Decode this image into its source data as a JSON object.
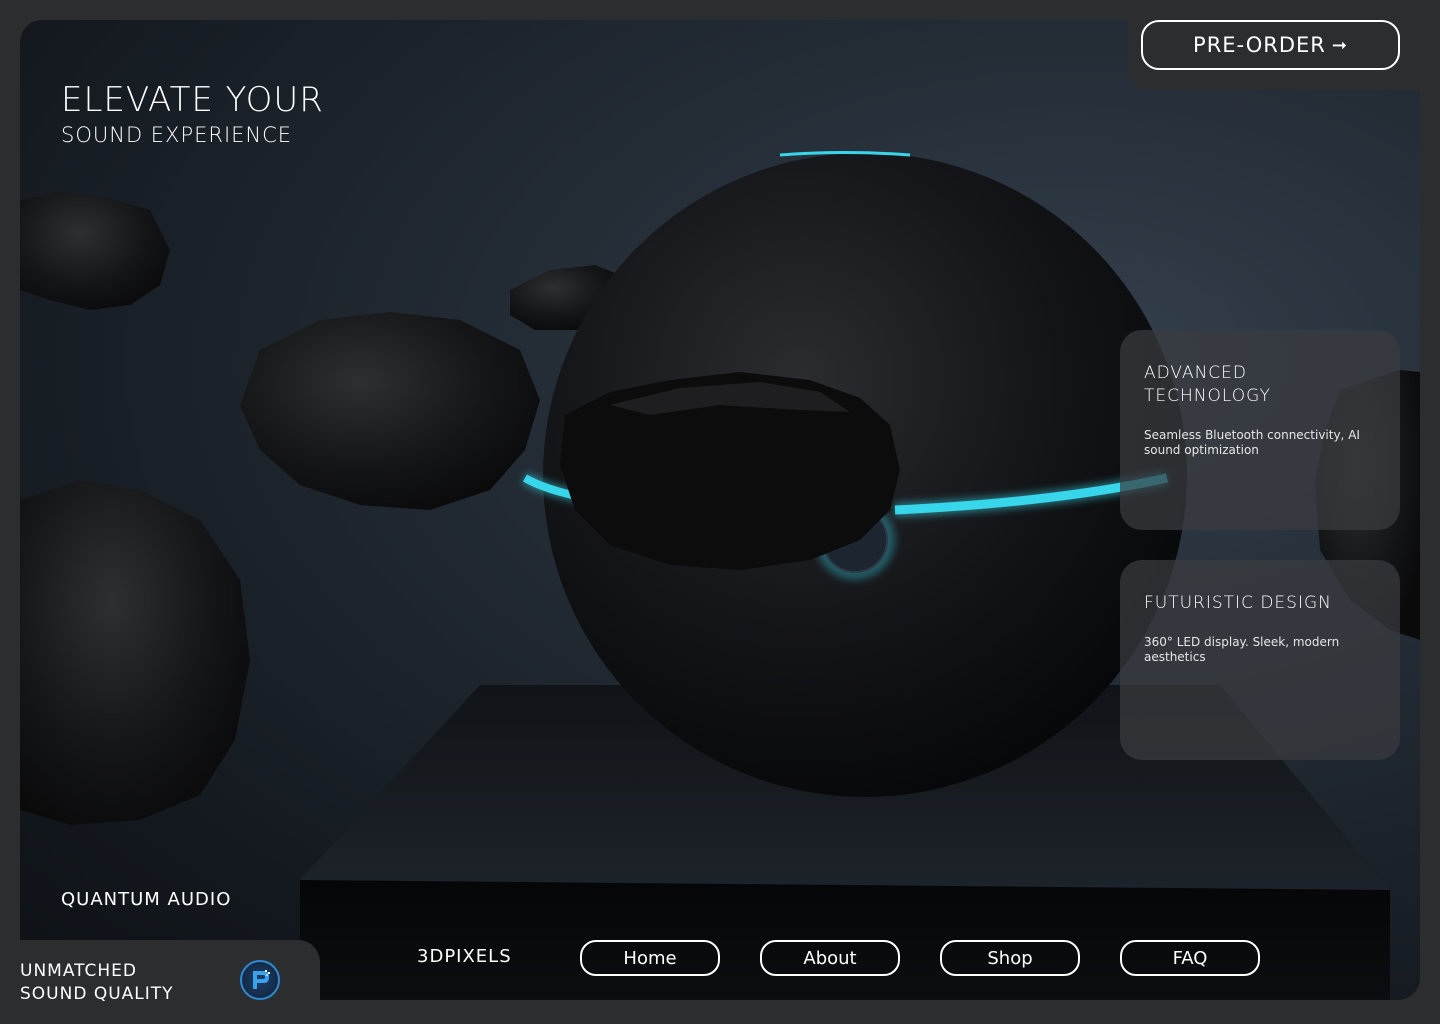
{
  "hero": {
    "title_line1": "ELEVATE YOUR",
    "title_line2": "SOUND EXPERIENCE",
    "brand": "QUANTUM AUDIO"
  },
  "header": {
    "preorder_label": "PRE-ORDER",
    "preorder_icon": "arrow-right-icon"
  },
  "features": [
    {
      "title": "ADVANCED TECHNOLOGY",
      "description": "Seamless Bluetooth connectivity, AI sound optimization"
    },
    {
      "title": "FUTURISTIC DESIGN",
      "description": "360° LED display. Sleek, modern aesthetics"
    }
  ],
  "footer": {
    "tagline_line1": "UNMATCHED",
    "tagline_line2": "SOUND QUALITY",
    "logo_icon": "3dpixels-logo-icon",
    "brand": "3DPIXELS",
    "nav": [
      {
        "label": "Home"
      },
      {
        "label": "About"
      },
      {
        "label": "Shop"
      },
      {
        "label": "FAQ"
      }
    ]
  },
  "colors": {
    "accent_led": "#37d6ea",
    "background": "#2c2d2f",
    "card": "#3a3c40"
  }
}
